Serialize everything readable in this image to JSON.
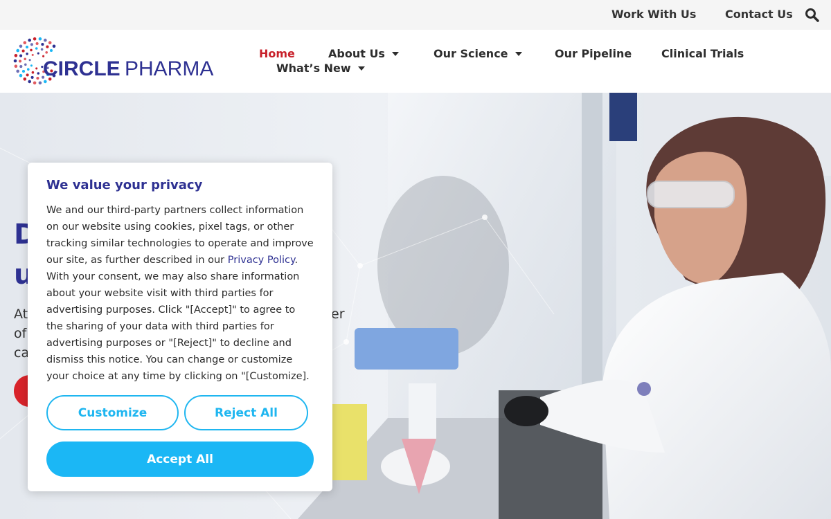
{
  "topbar": {
    "work_with_us": "Work With Us",
    "contact_us": "Contact Us",
    "search_icon": "search-icon"
  },
  "logo": {
    "word1": "CIRCLE",
    "word2": "PHARMA"
  },
  "nav": {
    "items": [
      {
        "label": "Home",
        "active": true
      },
      {
        "label": "About Us",
        "dropdown": true
      },
      {
        "label": "Our Science",
        "dropdown": true
      },
      {
        "label": "Our Pipeline"
      },
      {
        "label": "Clinical Trials"
      },
      {
        "label": "What’s New",
        "dropdown": true
      }
    ]
  },
  "hero": {
    "title_line1": "D",
    "title_line2": "u",
    "text_line1": "At",
    "text_line2": "of",
    "text_line3": "ca",
    "text_fragment": "er"
  },
  "cookie": {
    "title": "We value your privacy",
    "body_before_link": "We and our third-party partners collect information on our website using cookies, pixel tags, or other tracking similar technologies to operate and improve our site, as further described in our ",
    "link": "Privacy Policy",
    "body_after_link": ". With your consent, we may also share information about your website visit with third parties for advertising purposes. Click \"[Accept]\" to agree to the sharing of your data with third parties for advertising purposes or \"[Reject]\" to decline and dismiss this notice. You can change or customize your choice at any time by clicking on \"[Customize].",
    "customize_label": "Customize",
    "reject_label": "Reject All",
    "accept_label": "Accept All"
  },
  "colors": {
    "brand_navy": "#2e3192",
    "brand_red": "#c8202a",
    "accent_cyan": "#1bb7f5"
  }
}
